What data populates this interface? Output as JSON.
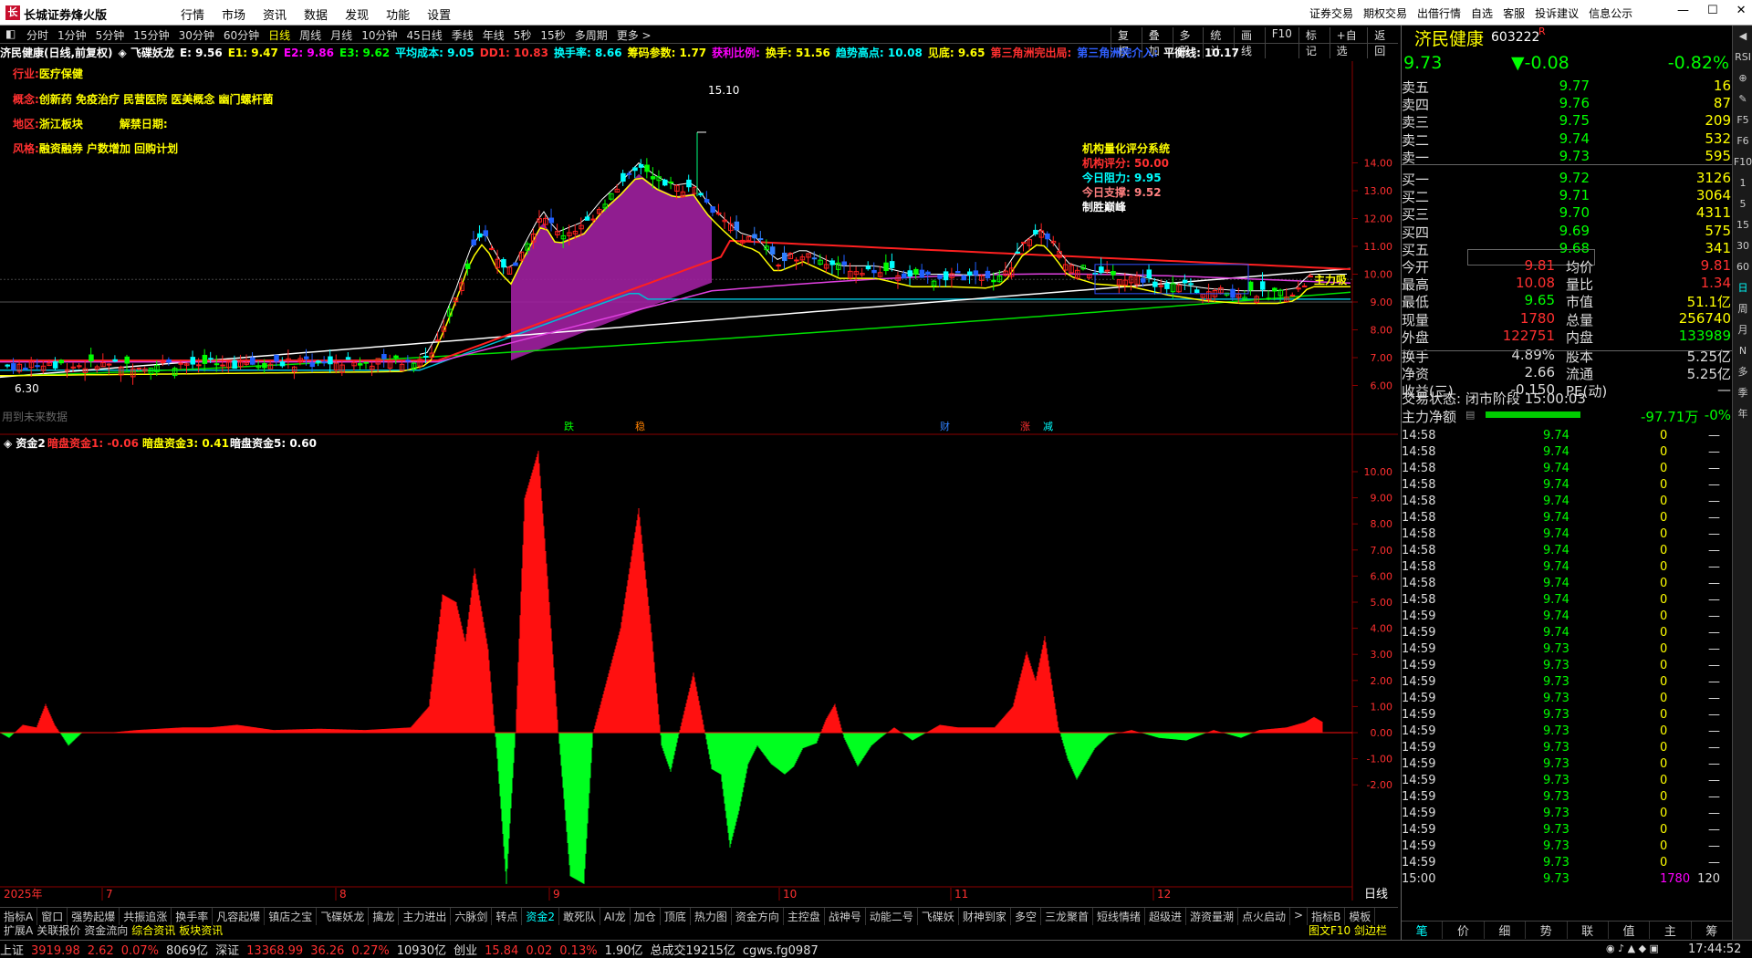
{
  "app": {
    "title": "长城证券烽火版",
    "menus": [
      "行情",
      "市场",
      "资讯",
      "数据",
      "发现",
      "功能",
      "设置"
    ],
    "right_menus": [
      "证券交易",
      "期权交易",
      "出借行情",
      "自选",
      "客服",
      "投诉建议",
      "信息公示"
    ]
  },
  "periods": {
    "items": [
      "分时",
      "1分钟",
      "5分钟",
      "15分钟",
      "30分钟",
      "60分钟",
      "日线",
      "周线",
      "月线",
      "10分钟",
      "45日线",
      "季线",
      "年线",
      "5秒",
      "15秒",
      "多周期",
      "更多 >"
    ],
    "active": 6,
    "right": [
      "复权",
      "叠加",
      "多股",
      "统计",
      "画线",
      "F10",
      "标记",
      "+自选",
      "返回"
    ]
  },
  "info": [
    {
      "text": "济民健康(日线,前复权)",
      "color": "#ffffff"
    },
    {
      "text": "◈ 飞碟妖龙",
      "color": "#ffffff"
    },
    {
      "text": "E: 9.56",
      "color": "#ffffff"
    },
    {
      "text": "E1: 9.47",
      "color": "#ffff00"
    },
    {
      "text": "E2: 9.86",
      "color": "#ff00ff"
    },
    {
      "text": "E3: 9.62",
      "color": "#00ff00"
    },
    {
      "text": "平均成本: 9.05",
      "color": "#00ffff"
    },
    {
      "text": "DD1: 10.83",
      "color": "#ff3030"
    },
    {
      "text": "换手率: 8.66",
      "color": "#00ffff"
    },
    {
      "text": "筹码参数: 1.77",
      "color": "#ffff00"
    },
    {
      "text": "获利比例:",
      "color": "#ff00ff"
    },
    {
      "text": "换手: 51.56",
      "color": "#ffff00"
    },
    {
      "text": "趋势高点: 10.08",
      "color": "#00ffff"
    },
    {
      "text": "见底: 9.65",
      "color": "#ffff00"
    },
    {
      "text": "第三角洲完出局:",
      "color": "#ff3030"
    },
    {
      "text": "第三角洲完介入:",
      "color": "#3060ff"
    },
    {
      "text": "平衡线: 10.17",
      "color": "#ffffff"
    }
  ],
  "overlays": {
    "industry_label": "行业:",
    "industry": "医疗保健",
    "concept_label": "概念:",
    "concept": "创新药 免疫治疗 民营医院 医美概念 幽门螺杆菌",
    "region_label": "地区:",
    "region": "浙江板块",
    "unlock_label": "解禁日期:",
    "style_label": "风格:",
    "style": "融资融券 户数增加 回购计划",
    "score_title": "机构量化评分系统",
    "score_line": "机构评分: 50.00",
    "resist_line": "今日阻力: 9.95",
    "support_line": "今日支撑: 9.52",
    "win_label": "制胜巅峰",
    "future_label": "用到未来数据",
    "peak_label": "15.10",
    "low_label": "6.30",
    "right_label": "主力吸",
    "event_labels": [
      "跌",
      "稳",
      "财",
      "涨",
      "减"
    ]
  },
  "main_axis": {
    "ticks": [
      "14.00",
      "13.00",
      "12.00",
      "11.00",
      "10.00",
      "9.00",
      "8.00",
      "7.00",
      "6.00"
    ]
  },
  "sub_info": [
    {
      "text": "◈ 资金2",
      "color": "#ffffff"
    },
    {
      "text": "暗盘资金1: -0.06",
      "color": "#ff3030"
    },
    {
      "text": "暗盘资金3: 0.41",
      "color": "#ffff00"
    },
    {
      "text": "暗盘资金5: 0.60",
      "color": "#ffffff"
    }
  ],
  "sub_axis": {
    "ticks": [
      "10.00",
      "9.00",
      "8.00",
      "7.00",
      "6.00",
      "5.00",
      "4.00",
      "3.00",
      "2.00",
      "1.00",
      "0.00",
      "-1.00",
      "-2.00"
    ]
  },
  "x_axis": {
    "labels": [
      "2025年",
      "7",
      "8",
      "9",
      "10",
      "11",
      "12"
    ],
    "period_btn": "日线"
  },
  "bottom_tabs": [
    "指标A",
    "窗口",
    "强势起爆",
    "共振追涨",
    "换手率",
    "凡容起爆",
    "镇店之宝",
    "飞碟妖龙",
    "擒龙",
    "主力进出",
    "六脉剑",
    "转点",
    "资金2",
    "敢死队",
    "AI龙",
    "加仓",
    "顶底",
    "热力图",
    "资金方向",
    "主控盘",
    "战神号",
    "动能二号",
    "飞碟妖",
    "财神到家",
    "多空",
    "三龙聚首",
    "短线情绪",
    "超级进",
    "游资量潮",
    "点火启动",
    ">",
    "指标B",
    "模板"
  ],
  "bottom_tabs_active": 12,
  "bottom_tabs2": [
    "扩展A",
    "关联报价",
    "资金流向",
    "综合资讯",
    "板块资讯"
  ],
  "bottom_tabs2_right": "图文F10  剑边栏 «",
  "statusbar": [
    {
      "text": "上证",
      "color": "#dddddd"
    },
    {
      "text": "3919.98",
      "color": "#ff3030"
    },
    {
      "text": "2.62",
      "color": "#ff3030"
    },
    {
      "text": "0.07%",
      "color": "#ff3030"
    },
    {
      "text": "8069亿",
      "color": "#dddddd"
    },
    {
      "text": "深证",
      "color": "#dddddd"
    },
    {
      "text": "13368.99",
      "color": "#ff3030"
    },
    {
      "text": "36.26",
      "color": "#ff3030"
    },
    {
      "text": "0.27%",
      "color": "#ff3030"
    },
    {
      "text": "10930亿",
      "color": "#dddddd"
    },
    {
      "text": "创业",
      "color": "#dddddd"
    },
    {
      "text": "15.84",
      "color": "#ff3030"
    },
    {
      "text": "0.02",
      "color": "#ff3030"
    },
    {
      "text": "0.13%",
      "color": "#ff3030"
    },
    {
      "text": "1.90亿",
      "color": "#dddddd"
    },
    {
      "text": "总成交19215亿",
      "color": "#dddddd"
    },
    {
      "text": "cgws.fg0987",
      "color": "#dddddd"
    }
  ],
  "clock": "17:44:52",
  "quote": {
    "name": "济民健康",
    "code": "603222",
    "price": "9.73",
    "change": "▼-0.08",
    "pct": "-0.82%",
    "asks": [
      {
        "label": "卖五",
        "price": "9.77",
        "vol": "16"
      },
      {
        "label": "卖四",
        "price": "9.76",
        "vol": "87"
      },
      {
        "label": "卖三",
        "price": "9.75",
        "vol": "209"
      },
      {
        "label": "卖二",
        "price": "9.74",
        "vol": "532"
      },
      {
        "label": "卖一",
        "price": "9.73",
        "vol": "595"
      }
    ],
    "bids": [
      {
        "label": "买一",
        "price": "9.72",
        "vol": "3126"
      },
      {
        "label": "买二",
        "price": "9.71",
        "vol": "3064"
      },
      {
        "label": "买三",
        "price": "9.70",
        "vol": "4311"
      },
      {
        "label": "买四",
        "price": "9.69",
        "vol": "575"
      },
      {
        "label": "买五",
        "price": "9.68",
        "vol": "341"
      }
    ],
    "stats": [
      {
        "l": "今开",
        "m": "9.81",
        "ml": "均价",
        "r": "9.81"
      },
      {
        "l": "最高",
        "m": "10.08",
        "ml": "量比",
        "r": "1.34"
      },
      {
        "l": "最低",
        "m": "9.65",
        "ml": "市值",
        "r": "51.1亿"
      },
      {
        "l": "现量",
        "m": "1780",
        "ml": "总量",
        "r": "256740"
      },
      {
        "l": "外盘",
        "m": "122751",
        "ml": "内盘",
        "r": "133989"
      },
      {
        "l": "换手",
        "m": "4.89%",
        "ml": "股本",
        "r": "5.25亿"
      },
      {
        "l": "净资",
        "m": "2.66",
        "ml": "流通",
        "r": "5.25亿"
      },
      {
        "l": "收益(三)",
        "m": "-0.150",
        "ml": "PE(动)",
        "r": "—"
      }
    ],
    "trade_status": "交易状态: 闭市阶段 15:00:03",
    "main_net_label": "主力净额",
    "main_net_value": "-97.71万",
    "main_net_pct": "-0%",
    "ticks": [
      [
        "14:58",
        "9.74",
        "0",
        "—"
      ],
      [
        "14:58",
        "9.74",
        "0",
        "—"
      ],
      [
        "14:58",
        "9.74",
        "0",
        "—"
      ],
      [
        "14:58",
        "9.74",
        "0",
        "—"
      ],
      [
        "14:58",
        "9.74",
        "0",
        "—"
      ],
      [
        "14:58",
        "9.74",
        "0",
        "—"
      ],
      [
        "14:58",
        "9.74",
        "0",
        "—"
      ],
      [
        "14:58",
        "9.74",
        "0",
        "—"
      ],
      [
        "14:58",
        "9.74",
        "0",
        "—"
      ],
      [
        "14:58",
        "9.74",
        "0",
        "—"
      ],
      [
        "14:58",
        "9.74",
        "0",
        "—"
      ],
      [
        "14:59",
        "9.74",
        "0",
        "—"
      ],
      [
        "14:59",
        "9.74",
        "0",
        "—"
      ],
      [
        "14:59",
        "9.73",
        "0",
        "—"
      ],
      [
        "14:59",
        "9.73",
        "0",
        "—"
      ],
      [
        "14:59",
        "9.73",
        "0",
        "—"
      ],
      [
        "14:59",
        "9.73",
        "0",
        "—"
      ],
      [
        "14:59",
        "9.73",
        "0",
        "—"
      ],
      [
        "14:59",
        "9.73",
        "0",
        "—"
      ],
      [
        "14:59",
        "9.73",
        "0",
        "—"
      ],
      [
        "14:59",
        "9.73",
        "0",
        "—"
      ],
      [
        "14:59",
        "9.73",
        "0",
        "—"
      ],
      [
        "14:59",
        "9.73",
        "0",
        "—"
      ],
      [
        "14:59",
        "9.73",
        "0",
        "—"
      ],
      [
        "14:59",
        "9.73",
        "0",
        "—"
      ],
      [
        "14:59",
        "9.73",
        "0",
        "—"
      ],
      [
        "14:59",
        "9.73",
        "0",
        "—"
      ],
      [
        "15:00",
        "9.73",
        "1780",
        "120"
      ]
    ],
    "tabs": [
      "笔",
      "价",
      "细",
      "势",
      "联",
      "值",
      "主",
      "筹"
    ]
  },
  "sidebar": [
    "◀",
    "RSI",
    "⊕",
    "✎",
    "F5",
    "F6",
    "F10",
    "1",
    "5",
    "15",
    "30",
    "60",
    "日",
    "周",
    "月",
    "N",
    "多",
    "季",
    "年"
  ],
  "colors": {
    "up": "#ff3030",
    "down": "#00ff00",
    "accent": "#00ffff",
    "bg": "#000000"
  }
}
